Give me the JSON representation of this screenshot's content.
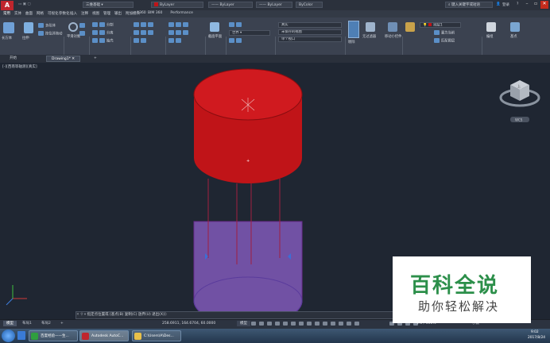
{
  "app": {
    "logo_letter": "A",
    "title_left": "AutoCAD 2016",
    "workspace": "三维基础",
    "layer_box": "ByLayer",
    "linetype_box": "ByLayer",
    "lineweight_box": "ByLayer",
    "color_box": "ByColor",
    "search_hint": "键入关键字或短语",
    "signin": "登录",
    "help": "?"
  },
  "menus": [
    "常用",
    "实体",
    "曲面",
    "网格",
    "可视化",
    "参数化",
    "插入",
    "注释",
    "视图",
    "管理",
    "输出",
    "附加模块",
    "A360",
    "BIM 360",
    "Performance"
  ],
  "ribbon": {
    "box_label": "长方体",
    "extrude_label": "拉伸",
    "smooth_label": "平滑对象",
    "group_modeling": "建模",
    "group_mesh": "网格",
    "group_solidedit": "实体编辑",
    "group_draw": "绘图",
    "group_modify": "修改",
    "group_section": "截面",
    "group_coords": "坐标",
    "group_view": "视图",
    "group_select": "选择",
    "group_layers": "图层",
    "group_groups": "组",
    "union_label": "多段体",
    "presspull_label": "按住并拖动",
    "visual_style": "真实",
    "unsaved_view": "未保存的视图",
    "viewport_config": "单个视口",
    "world": "世界",
    "nofilter": "无过滤器",
    "gizmo": "移动小控件",
    "layer_name": "图层1",
    "culling": "剔除",
    "section_plane": "截面平面",
    "split_label": "分割",
    "separate_label": "分离",
    "make_current": "置为当前",
    "match_layer": "匹配图层",
    "group_label": "编组",
    "base_label": "基点",
    "shell_label": "抽壳"
  },
  "doc_tabs": {
    "start": "开始",
    "drawing": "Drawing1*",
    "add": "+"
  },
  "viewport": {
    "label": "[-][西南等轴测][真实]",
    "navcube_face": "上",
    "wcs": "WCS",
    "colors": {
      "top_fill": "#c01418",
      "bottom_fill": "#7a57b0",
      "edge": "#6a2a8f"
    }
  },
  "command": {
    "prompt": "指定点位置或 [基点(B) 复制(C) 放弃(U) 退出(X)]:"
  },
  "status": {
    "model_tab": "模型",
    "layout1": "布局1",
    "layout2": "布局2",
    "coords": "258.6911, 164.6704, 60.0000",
    "model_btn": "模型",
    "scale": "1:1 / 100%",
    "decimal": "小数"
  },
  "taskbar": {
    "item1": "百度经验——生...",
    "item2": "Autodesk AutoC...",
    "item3": "C:\\Users\\A\\Des...",
    "time": "9:02",
    "date": "2017/8/24"
  },
  "watermark": {
    "line1": "百科全说",
    "line2": "助你轻松解决"
  }
}
